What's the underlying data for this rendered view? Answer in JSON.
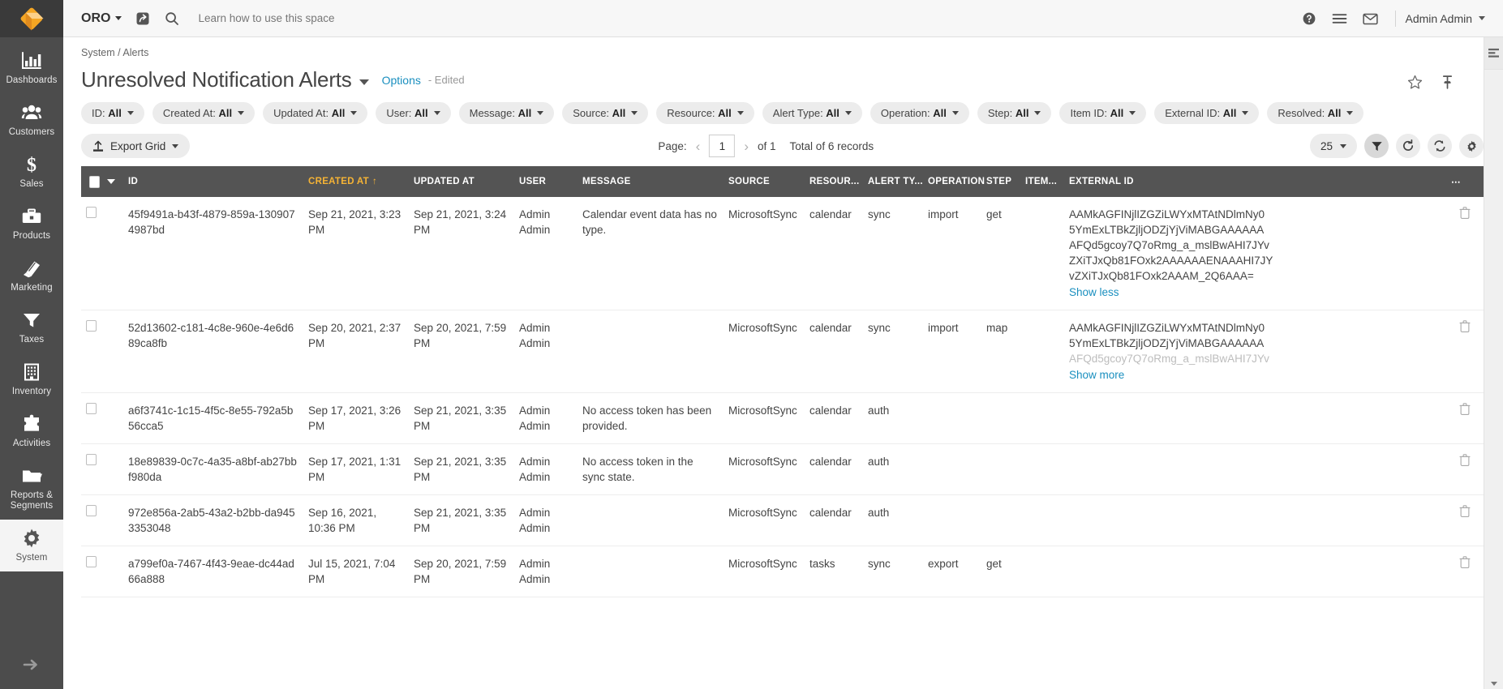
{
  "topbar": {
    "org": "ORO",
    "hint": "Learn how to use this space",
    "user": "Admin Admin",
    "icons": {
      "logo": "oro-logo-icon",
      "org_caret": "chevron-down-icon",
      "shortcut": "shortcut-icon",
      "search": "search-icon",
      "help": "help-circle-icon",
      "menu": "hamburger-menu-icon",
      "mail": "envelope-icon",
      "user_caret": "chevron-down-icon"
    }
  },
  "sidebar": {
    "items": [
      {
        "label": "Dashboards",
        "icon": "bar-chart-icon",
        "active": false
      },
      {
        "label": "Customers",
        "icon": "users-icon",
        "active": false
      },
      {
        "label": "Sales",
        "icon": "dollar-icon",
        "active": false
      },
      {
        "label": "Products",
        "icon": "briefcase-icon",
        "active": false
      },
      {
        "label": "Marketing",
        "icon": "megaphone-book-icon",
        "active": false
      },
      {
        "label": "Taxes",
        "icon": "funnel-icon",
        "active": false
      },
      {
        "label": "Inventory",
        "icon": "building-icon",
        "active": false
      },
      {
        "label": "Activities",
        "icon": "puzzle-icon",
        "active": false
      },
      {
        "label": "Reports &\nSegments",
        "icon": "folder-icon",
        "active": false
      },
      {
        "label": "System",
        "icon": "gear-icon",
        "active": true
      }
    ],
    "expand_icon": "arrow-right-icon"
  },
  "page": {
    "breadcrumb": "System / Alerts",
    "title": "Unresolved Notification Alerts",
    "options_label": "Options",
    "edited_label": "- Edited",
    "favorite_icon": "star-icon",
    "pin_icon": "pin-icon"
  },
  "filters": [
    {
      "label": "ID:",
      "value": "All"
    },
    {
      "label": "Created At:",
      "value": "All"
    },
    {
      "label": "Updated At:",
      "value": "All"
    },
    {
      "label": "User:",
      "value": "All"
    },
    {
      "label": "Message:",
      "value": "All"
    },
    {
      "label": "Source:",
      "value": "All"
    },
    {
      "label": "Resource:",
      "value": "All"
    },
    {
      "label": "Alert Type:",
      "value": "All"
    },
    {
      "label": "Operation:",
      "value": "All"
    },
    {
      "label": "Step:",
      "value": "All"
    },
    {
      "label": "Item ID:",
      "value": "All"
    },
    {
      "label": "External ID:",
      "value": "All"
    },
    {
      "label": "Resolved:",
      "value": "All"
    }
  ],
  "toolbar": {
    "export_label": "Export Grid",
    "export_icon": "upload-icon",
    "page_label": "Page:",
    "page_value": "1",
    "of_label": "of 1",
    "total_label": "Total of 6 records",
    "rows_per_page": "25",
    "prev_icon": "chevron-left-icon",
    "next_icon": "chevron-right-icon",
    "filter_icon": "funnel-icon",
    "reset_icon": "refresh-icon",
    "refresh_icon": "sync-icon",
    "settings_icon": "gear-icon"
  },
  "grid": {
    "columns": [
      "ID",
      "CREATED AT",
      "UPDATED AT",
      "USER",
      "MESSAGE",
      "SOURCE",
      "RESOUR...",
      "ALERT TY...",
      "OPERATION",
      "STEP",
      "ITEM...",
      "EXTERNAL ID"
    ],
    "sorted_column": "CREATED AT",
    "sort_direction": "↑",
    "more_icon": "ellipsis-icon",
    "delete_icon": "trash-icon",
    "show_less_label": "Show less",
    "show_more_label": "Show more",
    "rows": [
      {
        "id": "45f9491a-b43f-4879-859a-1309074987bd",
        "created_at": "Sep 21, 2021, 3:23 PM",
        "updated_at": "Sep 21, 2021, 3:24 PM",
        "user": "Admin Admin",
        "message": "Calendar event data has no type.",
        "source": "MicrosoftSync",
        "resource": "calendar",
        "alert_type": "sync",
        "operation": "import",
        "step": "get",
        "item_id": "",
        "external_id_lines": [
          "AAMkAGFINjlIZGZiLWYxMTAtNDlmNy0",
          "5YmExLTBkZjljODZjYjViMABGAAAAAA",
          "AFQd5gcoy7Q7oRmg_a_mslBwAHI7JYv",
          "ZXiTJxQb81FOxk2AAAAAAENAAAHI7JY",
          "vZXiTJxQb81FOxk2AAAM_2Q6AAA="
        ],
        "expand_label": "Show less",
        "expanded": true
      },
      {
        "id": "52d13602-c181-4c8e-960e-4e6d689ca8fb",
        "created_at": "Sep 20, 2021, 2:37 PM",
        "updated_at": "Sep 20, 2021, 7:59 PM",
        "user": "Admin Admin",
        "message": "",
        "source": "MicrosoftSync",
        "resource": "calendar",
        "alert_type": "sync",
        "operation": "import",
        "step": "map",
        "item_id": "",
        "external_id_lines": [
          "AAMkAGFINjlIZGZiLWYxMTAtNDlmNy0",
          "5YmExLTBkZjljODZjYjViMABGAAAAAA",
          "AFQd5gcoy7Q7oRmg_a_mslBwAHI7JYv"
        ],
        "expand_label": "Show more",
        "expanded": false
      },
      {
        "id": "a6f3741c-1c15-4f5c-8e55-792a5b56cca5",
        "created_at": "Sep 17, 2021, 3:26 PM",
        "updated_at": "Sep 21, 2021, 3:35 PM",
        "user": "Admin Admin",
        "message": "No access token has been provided.",
        "source": "MicrosoftSync",
        "resource": "calendar",
        "alert_type": "auth",
        "operation": "",
        "step": "",
        "item_id": "",
        "external_id_lines": [],
        "expand_label": "",
        "expanded": false
      },
      {
        "id": "18e89839-0c7c-4a35-a8bf-ab27bbf980da",
        "created_at": "Sep 17, 2021, 1:31 PM",
        "updated_at": "Sep 21, 2021, 3:35 PM",
        "user": "Admin Admin",
        "message": "No access token in the sync state.",
        "source": "MicrosoftSync",
        "resource": "calendar",
        "alert_type": "auth",
        "operation": "",
        "step": "",
        "item_id": "",
        "external_id_lines": [],
        "expand_label": "",
        "expanded": false
      },
      {
        "id": "972e856a-2ab5-43a2-b2bb-da9453353048",
        "created_at": "Sep 16, 2021, 10:36 PM",
        "updated_at": "Sep 21, 2021, 3:35 PM",
        "user": "Admin Admin",
        "message": "",
        "source": "MicrosoftSync",
        "resource": "calendar",
        "alert_type": "auth",
        "operation": "",
        "step": "",
        "item_id": "",
        "external_id_lines": [],
        "expand_label": "",
        "expanded": false
      },
      {
        "id": "a799ef0a-7467-4f43-9eae-dc44ad66a888",
        "created_at": "Jul 15, 2021, 7:04 PM",
        "updated_at": "Sep 20, 2021, 7:59 PM",
        "user": "Admin Admin",
        "message": "",
        "source": "MicrosoftSync",
        "resource": "tasks",
        "alert_type": "sync",
        "operation": "export",
        "step": "get",
        "item_id": "",
        "external_id_lines": [],
        "expand_label": "",
        "expanded": false
      }
    ]
  },
  "colors": {
    "sidebar_bg": "#4c4c4c",
    "header_bg": "#545454",
    "accent": "#f5b335",
    "link": "#1a8fbf"
  }
}
